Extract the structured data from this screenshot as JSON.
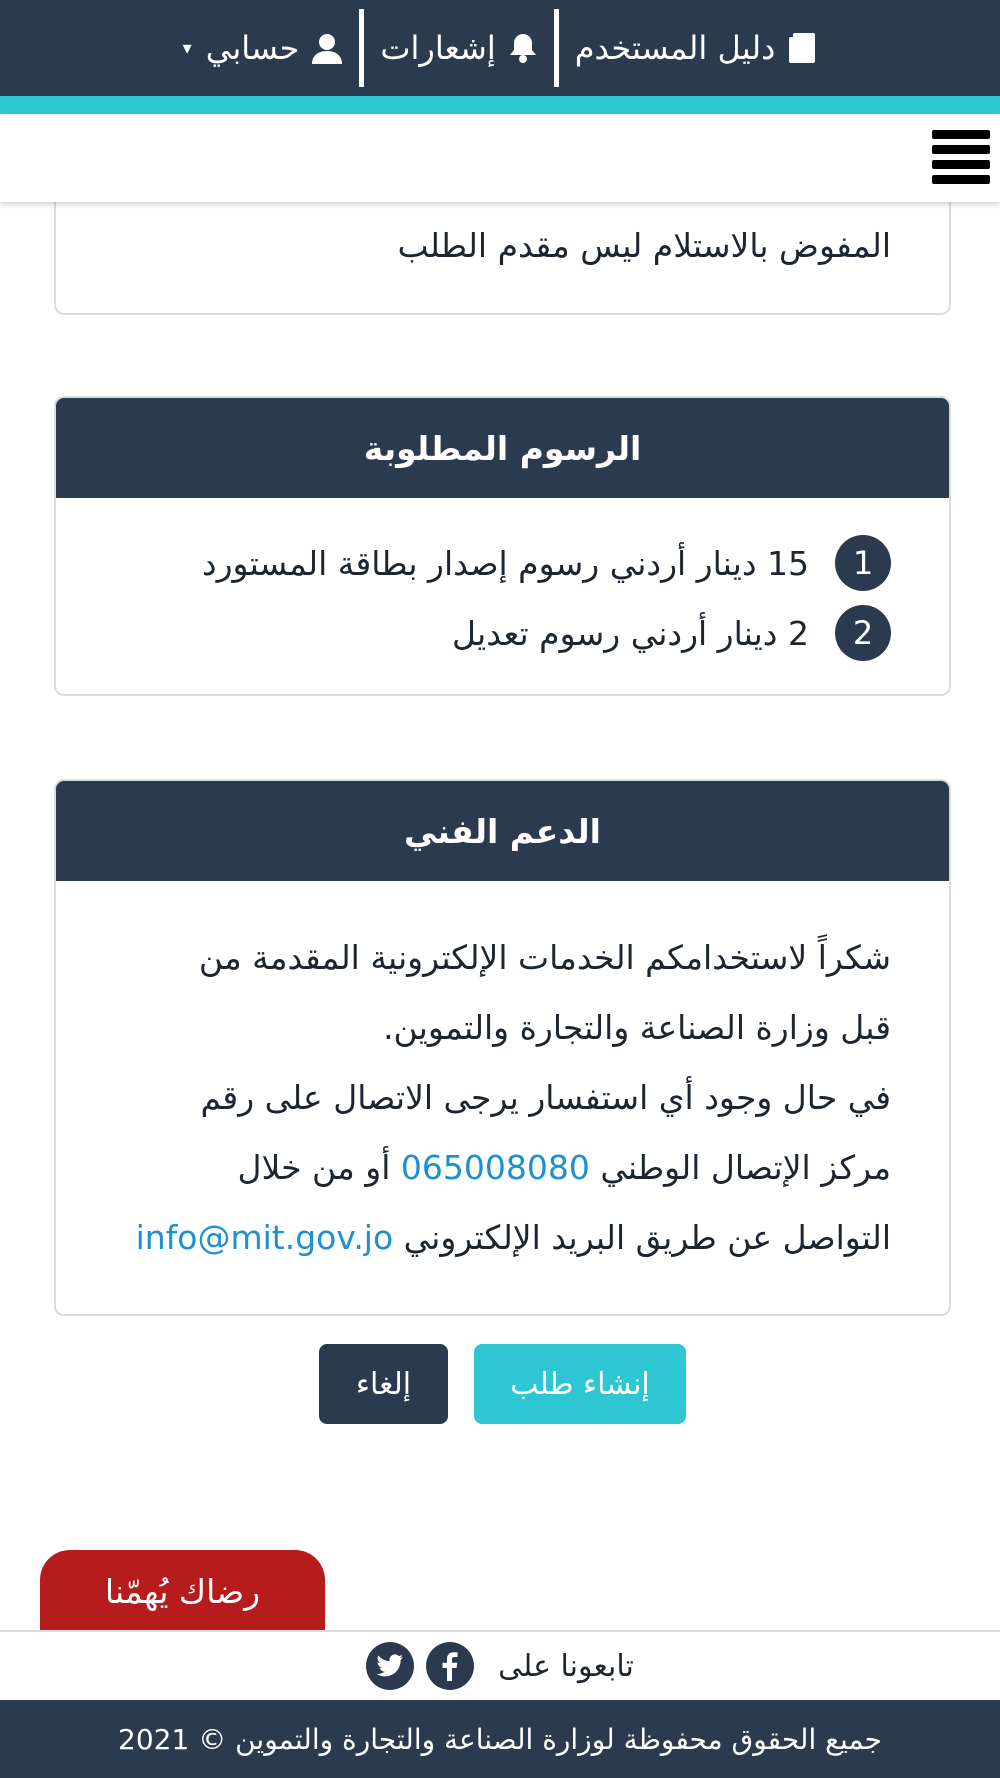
{
  "topbar": {
    "user_guide_label": "دليل المستخدم",
    "notifications_label": "إشعارات",
    "account_label": "حسابي",
    "caret": "▾"
  },
  "partial_card": {
    "text": "المفوض بالاستلام ليس مقدم الطلب"
  },
  "fees": {
    "title": "الرسوم المطلوبة",
    "items": [
      {
        "number": "1",
        "text": "15 دينار أردني رسوم إصدار بطاقة المستورد"
      },
      {
        "number": "2",
        "text": "2 دينار أردني رسوم تعديل"
      }
    ]
  },
  "support": {
    "title": "الدعم الفني",
    "line1": "شكراً لاستخدامكم الخدمات الإلكترونية المقدمة من",
    "line2": "قبل وزارة الصناعة والتجارة والتموين.",
    "line3": "في حال وجود أي استفسار يرجى الاتصال على رقم",
    "line4_before": "مركز الإتصال الوطني",
    "phone": "065008080",
    "line4_after": "أو من خلال",
    "line5_before": "التواصل عن طريق البريد الإلكتروني",
    "email": "info@mit.gov.jo"
  },
  "actions": {
    "create_label": "إنشاء طلب",
    "cancel_label": "إلغاء"
  },
  "feedback_label": "رضاك يُهمّنا",
  "follow": {
    "label": "تابعونا على"
  },
  "footer_text": "جميع الحقوق محفوظة لوزارة الصناعة والتجارة والتموين © 2021",
  "colors": {
    "navy": "#2c3a4f",
    "accent": "#2ec6d3",
    "feedback_red": "#b71c1c",
    "link_blue": "#1e8fd0"
  },
  "icons": [
    "book-icon",
    "bell-icon",
    "user-icon",
    "menu-icon",
    "facebook-icon",
    "twitter-icon"
  ]
}
